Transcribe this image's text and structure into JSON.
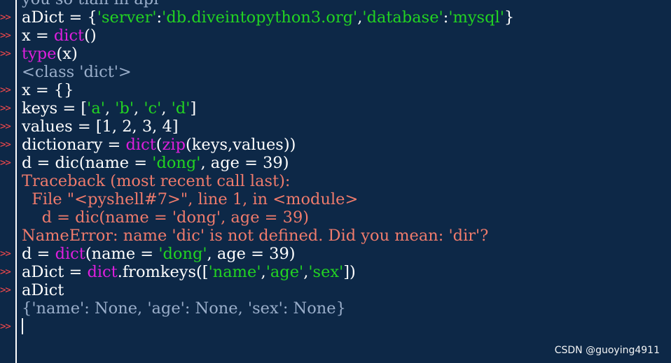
{
  "prompt_symbol": ">>",
  "colors": {
    "background": "#0d2847",
    "default_text": "#ffffff",
    "prompt": "#ff4a4a",
    "string": "#22d322",
    "builtin": "#dd1fdd",
    "output": "#9aaeca",
    "error": "#ef7b6c"
  },
  "lines": [
    {
      "prompt": false,
      "tokens": [
        {
          "t": "you so tian in api",
          "c": "out"
        }
      ]
    },
    {
      "prompt": true,
      "tokens": [
        {
          "t": "aDict = {"
        },
        {
          "t": "'server'",
          "c": "str"
        },
        {
          "t": ":"
        },
        {
          "t": "'db.diveintopython3.org'",
          "c": "str"
        },
        {
          "t": ","
        },
        {
          "t": "'database'",
          "c": "str"
        },
        {
          "t": ":"
        },
        {
          "t": "'mysql'",
          "c": "str"
        },
        {
          "t": "}"
        }
      ]
    },
    {
      "prompt": true,
      "tokens": [
        {
          "t": "x = "
        },
        {
          "t": "dict",
          "c": "builtin"
        },
        {
          "t": "()"
        }
      ]
    },
    {
      "prompt": true,
      "tokens": [
        {
          "t": "type",
          "c": "builtin"
        },
        {
          "t": "(x)"
        }
      ]
    },
    {
      "prompt": false,
      "tokens": [
        {
          "t": "<class 'dict'>",
          "c": "out"
        }
      ]
    },
    {
      "prompt": true,
      "tokens": [
        {
          "t": "x = {}"
        }
      ]
    },
    {
      "prompt": true,
      "tokens": [
        {
          "t": "keys = ["
        },
        {
          "t": "'a'",
          "c": "str"
        },
        {
          "t": ", "
        },
        {
          "t": "'b'",
          "c": "str"
        },
        {
          "t": ", "
        },
        {
          "t": "'c'",
          "c": "str"
        },
        {
          "t": ", "
        },
        {
          "t": "'d'",
          "c": "str"
        },
        {
          "t": "]"
        }
      ]
    },
    {
      "prompt": true,
      "tokens": [
        {
          "t": "values = [1, 2, 3, 4]"
        }
      ]
    },
    {
      "prompt": true,
      "tokens": [
        {
          "t": "dictionary = "
        },
        {
          "t": "dict",
          "c": "builtin"
        },
        {
          "t": "("
        },
        {
          "t": "zip",
          "c": "builtin"
        },
        {
          "t": "(keys,values))"
        }
      ]
    },
    {
      "prompt": true,
      "tokens": [
        {
          "t": "d = dic(name = "
        },
        {
          "t": "'dong'",
          "c": "str"
        },
        {
          "t": ", age = 39)"
        }
      ]
    },
    {
      "prompt": false,
      "tokens": [
        {
          "t": "Traceback (most recent call last):",
          "c": "err"
        }
      ]
    },
    {
      "prompt": false,
      "tokens": [
        {
          "t": "  File \"<pyshell#7>\", line 1, in <module>",
          "c": "err"
        }
      ]
    },
    {
      "prompt": false,
      "tokens": [
        {
          "t": "    d = dic(name = 'dong', age = 39)",
          "c": "err"
        }
      ]
    },
    {
      "prompt": false,
      "tokens": [
        {
          "t": "NameError: name 'dic' is not defined. Did you mean: 'dir'?",
          "c": "err"
        }
      ]
    },
    {
      "prompt": true,
      "tokens": [
        {
          "t": "d = "
        },
        {
          "t": "dict",
          "c": "builtin"
        },
        {
          "t": "(name = "
        },
        {
          "t": "'dong'",
          "c": "str"
        },
        {
          "t": ", age = 39)"
        }
      ]
    },
    {
      "prompt": true,
      "tokens": [
        {
          "t": "aDict = "
        },
        {
          "t": "dict",
          "c": "builtin"
        },
        {
          "t": ".fromkeys(["
        },
        {
          "t": "'name'",
          "c": "str"
        },
        {
          "t": ","
        },
        {
          "t": "'age'",
          "c": "str"
        },
        {
          "t": ","
        },
        {
          "t": "'sex'",
          "c": "str"
        },
        {
          "t": "])"
        }
      ]
    },
    {
      "prompt": true,
      "tokens": [
        {
          "t": "aDict"
        }
      ]
    },
    {
      "prompt": false,
      "tokens": [
        {
          "t": "{'name': None, 'age': None, 'sex': None}",
          "c": "out"
        }
      ]
    },
    {
      "prompt": true,
      "tokens": [],
      "cursor": true
    }
  ],
  "watermark": "CSDN @guoying4911"
}
